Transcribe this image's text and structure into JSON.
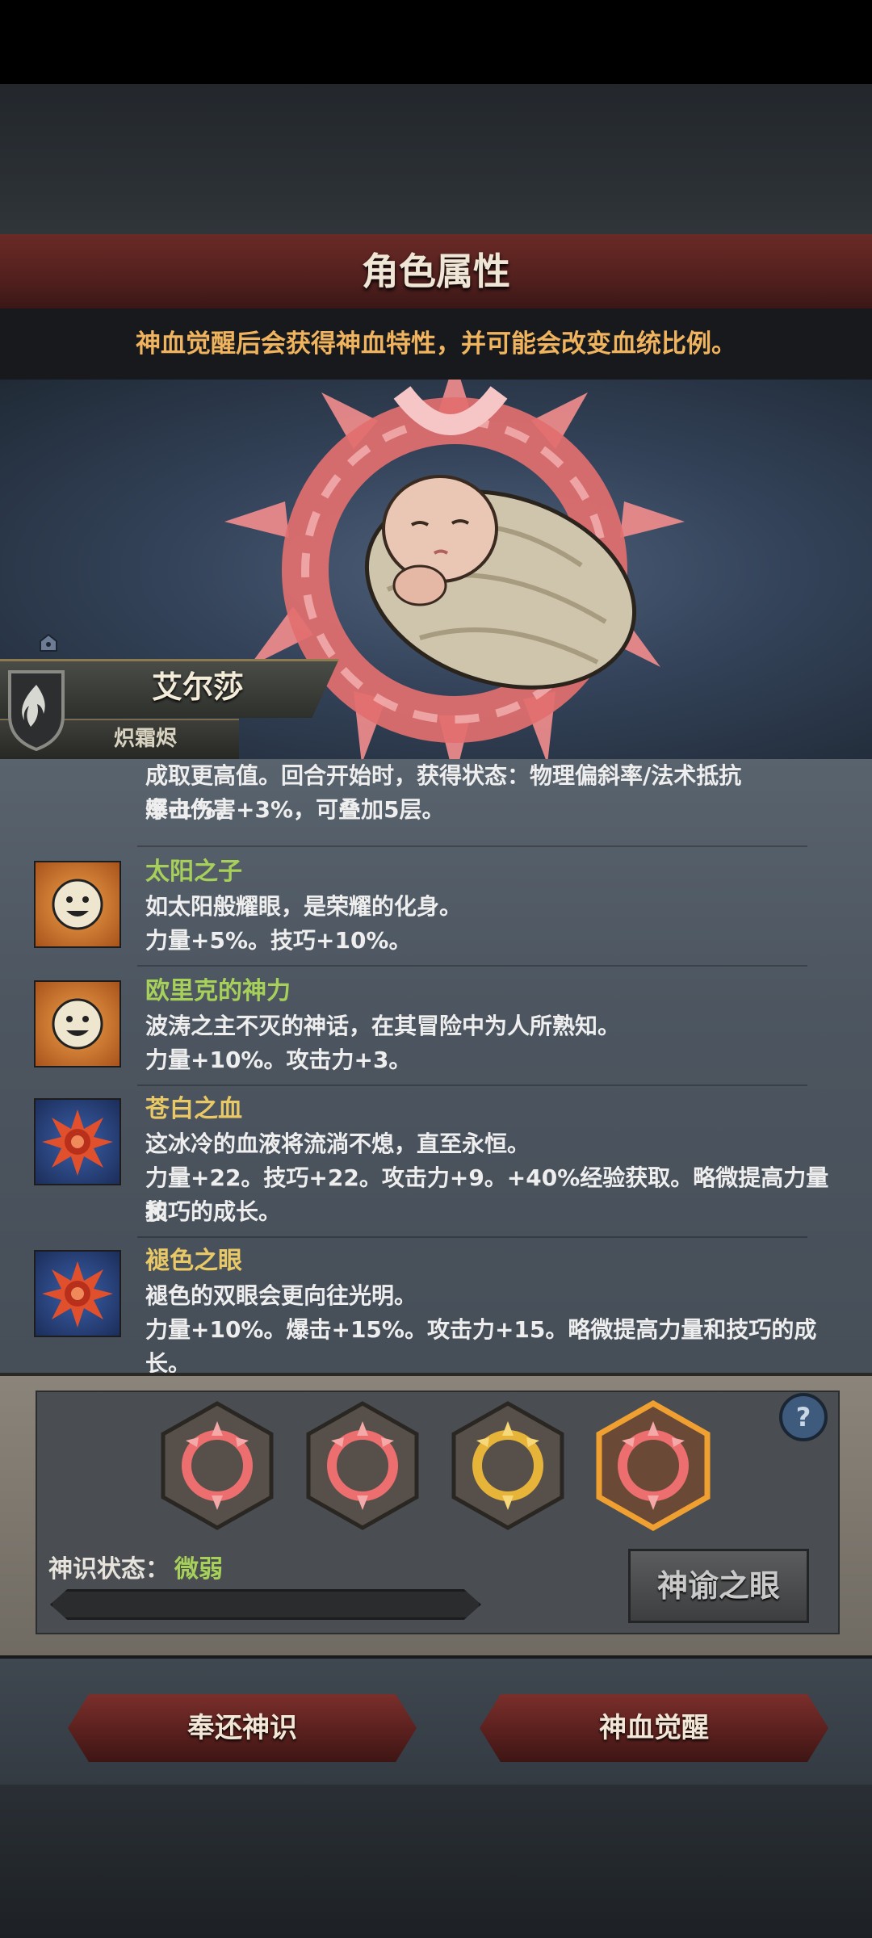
{
  "header": {
    "title": "角色属性",
    "subtitle": "神血觉醒后会获得神血特性，并可能会改变血统比例。"
  },
  "character": {
    "name": "艾尔莎",
    "class": "炽霜烬"
  },
  "traits": [
    {
      "name": "",
      "lines": [
        "成取更高值。回合开始时，获得状态：物理偏斜率/法术抵抗率-1%，",
        "爆击伤害+3%，可叠加5层。"
      ]
    },
    {
      "name": "太阳之子",
      "icon": "sun-smiley-icon",
      "lines": [
        "如太阳般耀眼，是荣耀的化身。",
        "力量+5%。技巧+10%。"
      ]
    },
    {
      "name": "欧里克的神力",
      "icon": "sun-smiley-icon",
      "lines": [
        "波涛之主不灭的神话，在其冒险中为人所熟知。",
        "力量+10%。攻击力+3。"
      ]
    },
    {
      "name": "苍白之血",
      "icon": "blood-sun-icon",
      "lines": [
        "这冰冷的血液将流淌不熄，直至永恒。",
        "力量+22。技巧+22。攻击力+9。+40%经验获取。略微提高力量和",
        "技巧的成长。"
      ]
    },
    {
      "name": "褪色之眼",
      "icon": "blood-sun-icon",
      "lines": [
        "褪色的双眼会更向往光明。",
        "力量+10%。爆击+15%。攻击力+15。略微提高力量和技巧的成长。"
      ]
    }
  ],
  "god_panel": {
    "status_label": "神识状态：",
    "status_value": "微弱",
    "progress": 0.0,
    "oracle_button": "神谕之眼",
    "slots": [
      "red-sun-ring",
      "red-sun-ring",
      "gold-sun-ring",
      "red-sun-ring-selected"
    ]
  },
  "actions": {
    "return": "奉还神识",
    "awaken": "神血觉醒"
  },
  "colors": {
    "accent_green": "#a6d05a",
    "accent_gold": "#e9c866",
    "banner_red": "#5a201e",
    "subtitle_orange": "#f0b35e"
  }
}
